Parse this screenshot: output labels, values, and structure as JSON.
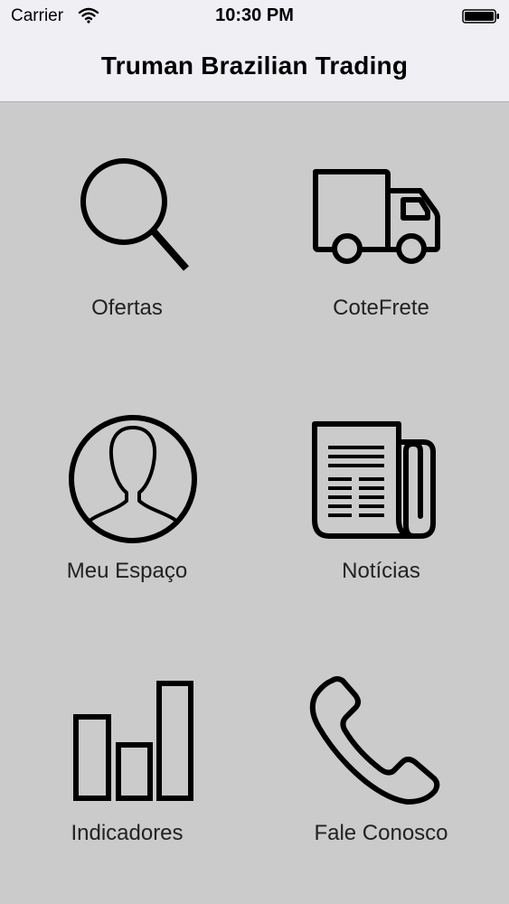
{
  "status_bar": {
    "carrier": "Carrier",
    "time": "10:30 PM"
  },
  "nav": {
    "title": "Truman Brazilian Trading"
  },
  "menu": [
    {
      "label": "Ofertas",
      "icon": "search-icon"
    },
    {
      "label": "CoteFrete",
      "icon": "truck-icon"
    },
    {
      "label": "Meu Espaço",
      "icon": "user-profile-icon"
    },
    {
      "label": "Notícias",
      "icon": "newspaper-icon"
    },
    {
      "label": "Indicadores",
      "icon": "bar-chart-icon"
    },
    {
      "label": "Fale Conosco",
      "icon": "phone-icon"
    }
  ],
  "colors": {
    "background": "#cbcbcc",
    "bar_background": "#efeff4",
    "icon": "#000000"
  }
}
